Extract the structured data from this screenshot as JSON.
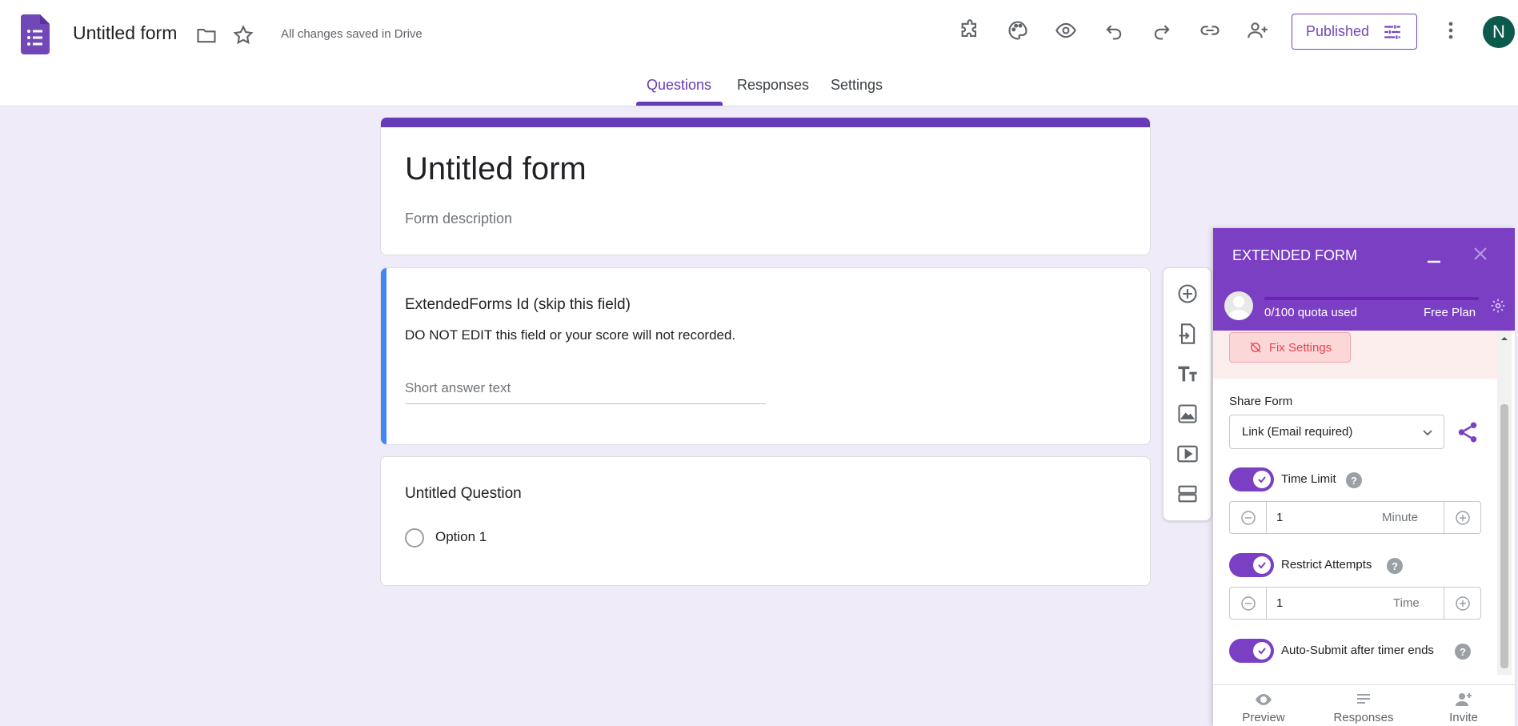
{
  "app": {
    "title": "Untitled form",
    "saved_status": "All changes saved in Drive",
    "published_label": "Published",
    "avatar_initial": "N"
  },
  "tabs": [
    {
      "label": "Questions",
      "active": true
    },
    {
      "label": "Responses",
      "active": false
    },
    {
      "label": "Settings",
      "active": false
    }
  ],
  "form": {
    "title": "Untitled form",
    "description_placeholder": "Form description"
  },
  "questions": [
    {
      "title": "ExtendedForms Id (skip this field)",
      "description": "DO NOT EDIT this field or your score will not recorded.",
      "answer_placeholder": "Short answer text"
    },
    {
      "title": "Untitled Question",
      "options": [
        "Option 1"
      ]
    }
  ],
  "panel": {
    "title": "EXTENDED FORM",
    "quota": "0/100 quota used",
    "plan": "Free Plan",
    "fix_settings_label": "Fix Settings",
    "share_form_label": "Share Form",
    "share_select_value": "Link (Email required)",
    "time_limit": {
      "label": "Time Limit",
      "enabled": true,
      "value": "1",
      "unit": "Minute"
    },
    "restrict_attempts": {
      "label": "Restrict Attempts",
      "enabled": true,
      "value": "1",
      "unit": "Time"
    },
    "auto_submit": {
      "label": "Auto-Submit after timer ends",
      "enabled": true
    },
    "footer": [
      {
        "label": "Preview",
        "icon": "eye-icon"
      },
      {
        "label": "Responses",
        "icon": "list-icon"
      },
      {
        "label": "Invite",
        "icon": "person-add-icon"
      }
    ]
  },
  "colors": {
    "accent": "#673ab7",
    "panel_header": "#7b3fc4",
    "background": "#f0ebf8",
    "question_highlight": "#4285f4",
    "warning": "#e8444c"
  }
}
